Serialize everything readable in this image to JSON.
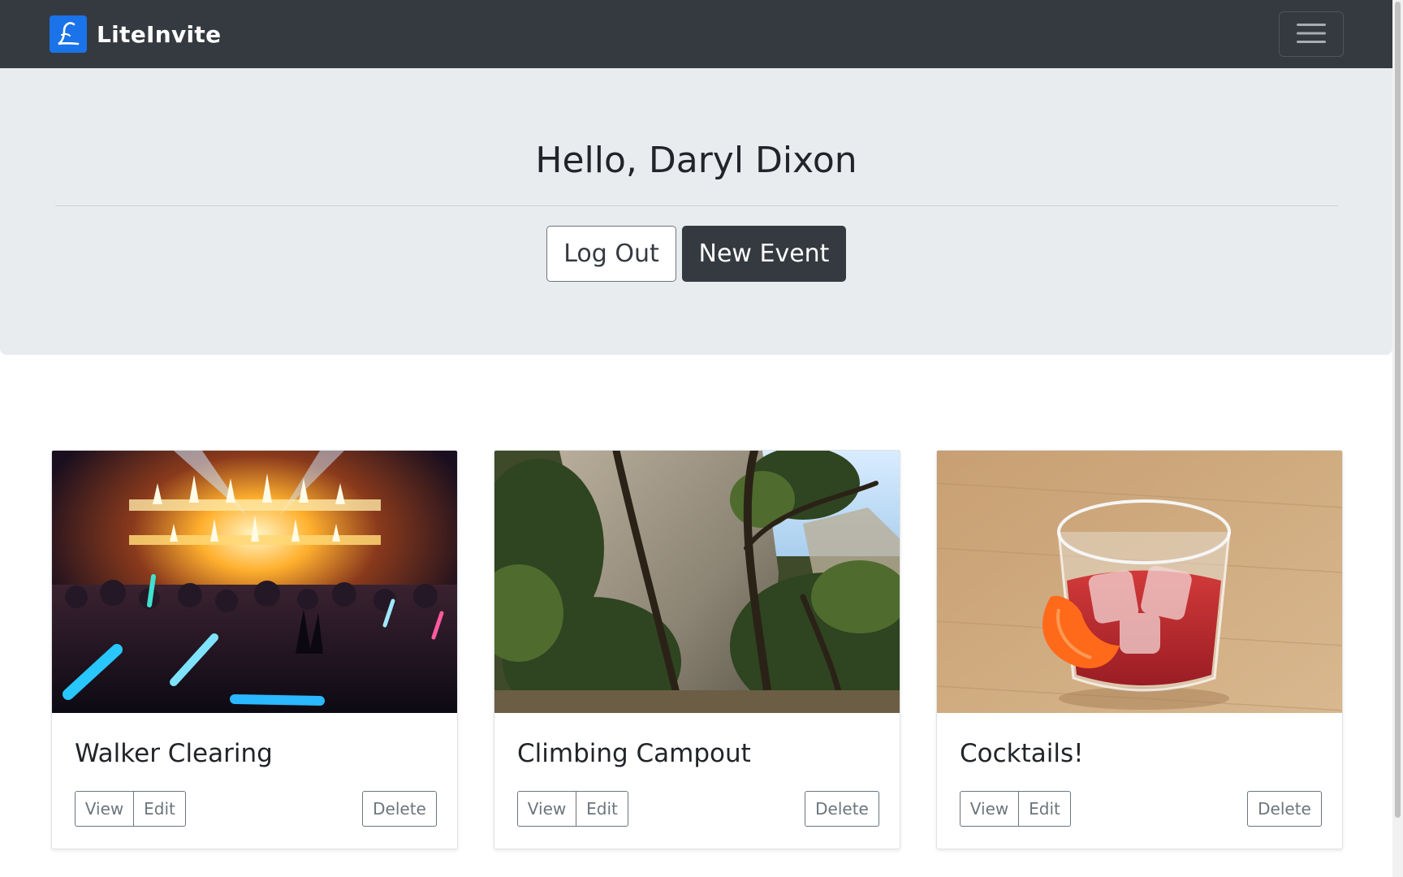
{
  "navbar": {
    "brand_logo_letter": "L",
    "brand_name": "LiteInvite",
    "menu_icon": "hamburger-menu-icon"
  },
  "hero": {
    "greeting": "Hello, Daryl Dixon",
    "logout_label": "Log Out",
    "new_event_label": "New Event"
  },
  "events": [
    {
      "title": "Walker Clearing",
      "image": "concert crowd with stage lights and flames",
      "view_label": "View",
      "edit_label": "Edit",
      "delete_label": "Delete"
    },
    {
      "title": "Climbing Campout",
      "image": "rock face and trees in forest",
      "view_label": "View",
      "edit_label": "Edit",
      "delete_label": "Delete"
    },
    {
      "title": "Cocktails!",
      "image": "red cocktail with ice and orange peel on wooden table",
      "view_label": "View",
      "edit_label": "Edit",
      "delete_label": "Delete"
    }
  ],
  "colors": {
    "navbar_bg": "#343a40",
    "hero_bg": "#e9ecef",
    "brand_logo_bg": "#1a73e8",
    "primary_dark": "#343a40",
    "outline_gray": "#6c757d"
  }
}
